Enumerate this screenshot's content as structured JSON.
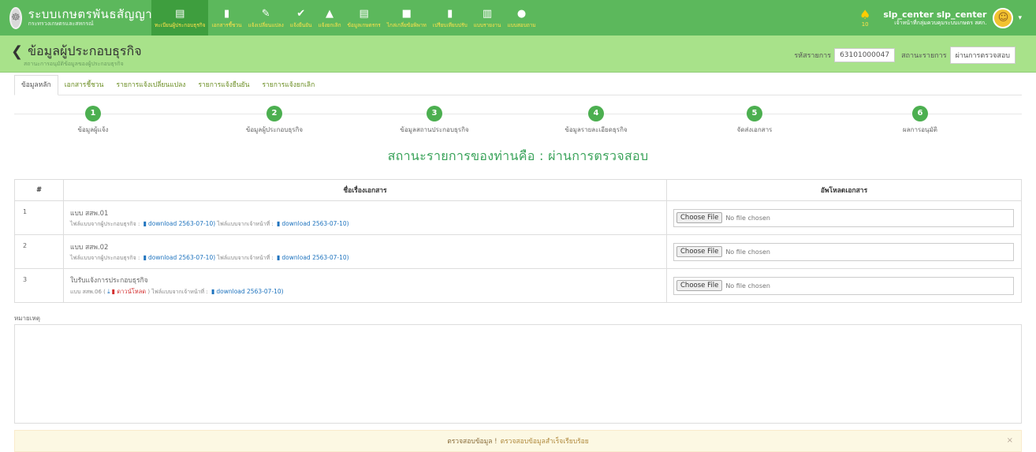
{
  "brand": {
    "title": "ระบบเกษตรพันธสัญญา",
    "subtitle": "กระทรวงเกษตรและสหกรณ์"
  },
  "nav": [
    {
      "icon": "id-card-icon",
      "label": "ทะเบียนผู้ประกอบธุรกิจ",
      "active": true
    },
    {
      "icon": "document-icon",
      "label": "เอกสารชี้ชวน"
    },
    {
      "icon": "edit-icon",
      "label": "แจ้งเปลี่ยนแปลง"
    },
    {
      "icon": "check-icon",
      "label": "แจ้งยืนยัน"
    },
    {
      "icon": "warning-icon",
      "label": "แจ้งยกเลิก"
    },
    {
      "icon": "id-card-icon",
      "label": "ข้อมูลเกษตรกร"
    },
    {
      "icon": "chat-icon",
      "label": "ไกล่เกลี่ยข้อพิพาท"
    },
    {
      "icon": "clipboard-icon",
      "label": "เปรียบเทียบปรับ"
    },
    {
      "icon": "chart-icon",
      "label": "แบบรายงาน"
    },
    {
      "icon": "users-icon",
      "label": "แบบสอบถาม"
    }
  ],
  "notifications": {
    "count": "10"
  },
  "user": {
    "name": "slp_center slp_center",
    "org": "เจ้าหน้าที่กลุ่มควบคุมระบบเกษตร สศก."
  },
  "page": {
    "title": "ข้อมูลผู้ประกอบธุรกิจ",
    "subtitle": "สถานะการอนุมัติข้อมูลของผู้ประกอบธุรกิจ",
    "ref_label": "รหัสรายการ",
    "ref_value": "63101000047",
    "status_label": "สถานะรายการ",
    "status_value": "ผ่านการตรวจสอบ"
  },
  "tabs": [
    {
      "label": "ข้อมูลหลัก",
      "active": true
    },
    {
      "label": "เอกสารชี้ชวน"
    },
    {
      "label": "รายการแจ้งเปลี่ยนแปลง"
    },
    {
      "label": "รายการแจ้งยืนยัน"
    },
    {
      "label": "รายการแจ้งยกเลิก"
    }
  ],
  "steps": [
    {
      "num": "1",
      "label": "ข้อมูลผู้แจ้ง"
    },
    {
      "num": "2",
      "label": "ข้อมูลผู้ประกอบธุรกิจ"
    },
    {
      "num": "3",
      "label": "ข้อมูลสถานประกอบธุรกิจ"
    },
    {
      "num": "4",
      "label": "ข้อมูลรายละเอียดธุรกิจ"
    },
    {
      "num": "5",
      "label": "จัดส่งเอกสาร"
    },
    {
      "num": "6",
      "label": "ผลการอนุมัติ"
    }
  ],
  "status_heading": "สถานะรายการของท่านคือ : ผ่านการตรวจสอบ",
  "table": {
    "headers": [
      "#",
      "ชื่อเรื่องเอกสาร",
      "อัพโหลดเอกสาร"
    ],
    "rows": [
      {
        "num": "1",
        "title": "แบบ สสพ.01",
        "l1": "ไฟล์แบบจากผู้ประกอบธุรกิจ :",
        "d1": "download 2563-07-10)",
        "l2": "ไฟล์แบบจากเจ้าหน้าที่ :",
        "d2": "download 2563-07-10)"
      },
      {
        "num": "2",
        "title": "แบบ สสพ.02",
        "l1": "ไฟล์แบบจากผู้ประกอบธุรกิจ :",
        "d1": "download 2563-07-10)",
        "l2": "ไฟล์แบบจากเจ้าหน้าที่ :",
        "d2": "download 2563-07-10)"
      },
      {
        "num": "3",
        "title": "ใบรับแจ้งการประกอบธุรกิจ",
        "l1": "แบบ สสพ.06 (",
        "d1": "ดาวน์โหลด",
        "l2": ") ไฟล์แบบจากเจ้าหน้าที่ :",
        "d2": "download 2563-07-10)"
      }
    ],
    "file_button": "Choose File",
    "file_note": "No file chosen"
  },
  "remark": {
    "label": "หมายเหตุ",
    "value": ""
  },
  "alert": {
    "strong": "ตรวจสอบข้อมูล !",
    "message": "ตรวจสอบข้อมูลสำเร็จเรียบร้อย",
    "close": "×"
  },
  "colors": {
    "topbar": "#5cb85c",
    "header": "#a8e28a",
    "accent_green": "#3aa35a",
    "link_blue": "#1e73be",
    "alert_bg": "#fcf8e3"
  }
}
